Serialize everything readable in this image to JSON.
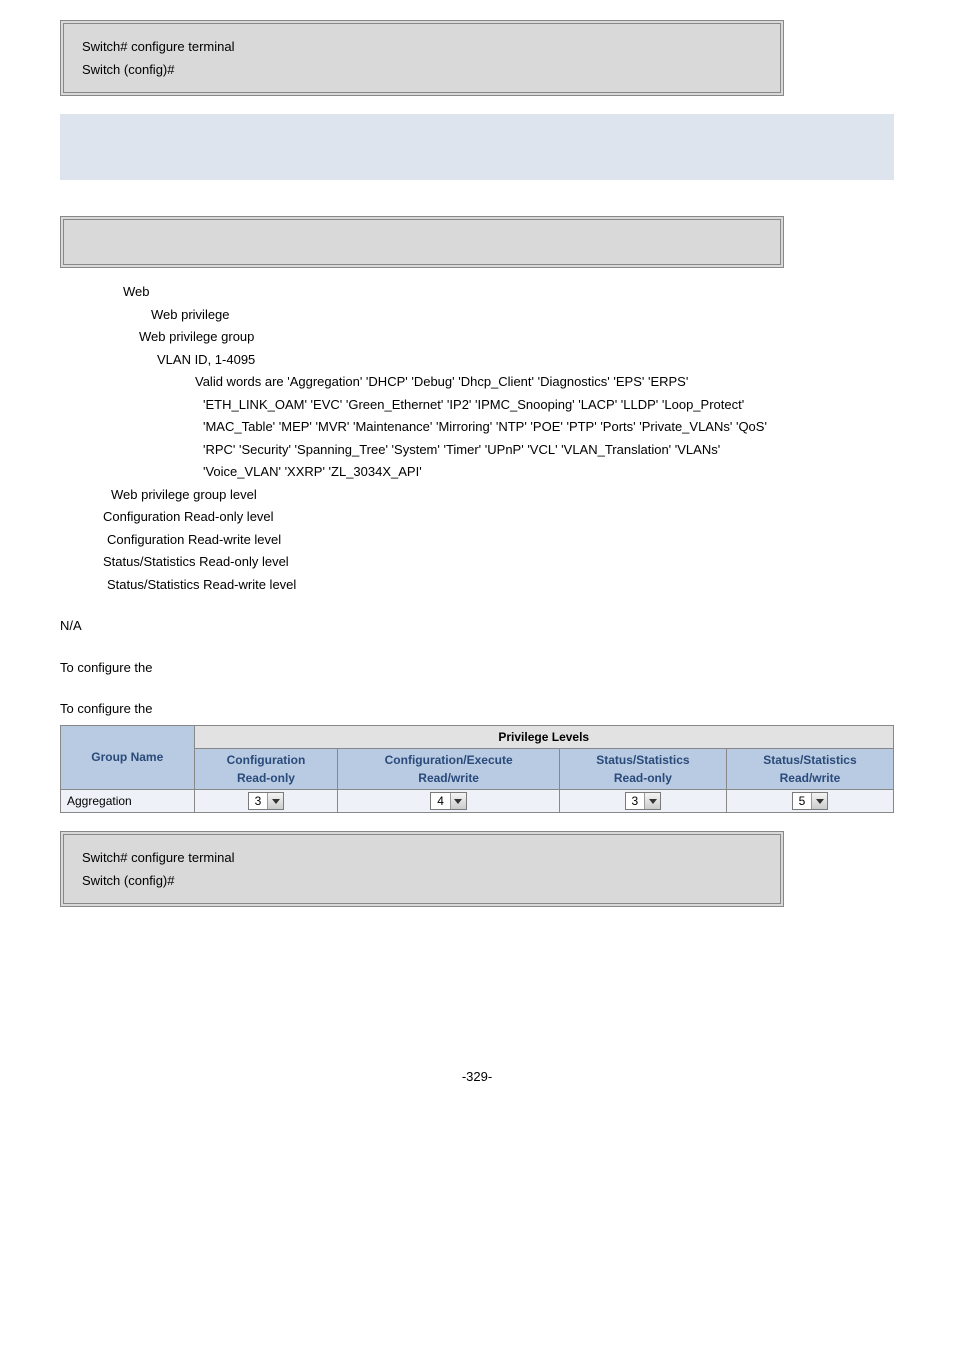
{
  "codebox1": {
    "line1": "Switch# configure terminal",
    "line2": "Switch (config)#"
  },
  "params": {
    "web": "Web",
    "web_privilege": "Web privilege",
    "web_priv_group": "Web privilege group",
    "vlan": "VLAN ID, 1-4095",
    "valid1": "Valid words are 'Aggregation' 'DHCP' 'Debug' 'Dhcp_Client' 'Diagnostics' 'EPS' 'ERPS'",
    "valid2": "'ETH_LINK_OAM' 'EVC' 'Green_Ethernet' 'IP2' 'IPMC_Snooping' 'LACP' 'LLDP' 'Loop_Protect'",
    "valid3": "'MAC_Table' 'MEP' 'MVR' 'Maintenance' 'Mirroring' 'NTP' 'POE' 'PTP' 'Ports' 'Private_VLANs' 'QoS'",
    "valid4": "'RPC' 'Security' 'Spanning_Tree' 'System' 'Timer' 'UPnP' 'VCL' 'VLAN_Translation' 'VLANs'",
    "valid5": "'Voice_VLAN' 'XXRP' 'ZL_3034X_API'",
    "grp_level": "Web privilege group level",
    "cfg_ro": "Configuration Read-only level",
    "cfg_rw": "Configuration Read-write level",
    "stat_ro": "Status/Statistics Read-only level",
    "stat_rw": "Status/Statistics Read-write level"
  },
  "na": "N/A",
  "configure1": "To configure the",
  "configure2": "To configure the",
  "table": {
    "title": "Privilege Levels",
    "col_gname": "Group Name",
    "col1a": "Configuration",
    "col1b": "Read-only",
    "col2a": "Configuration/Execute",
    "col2b": "Read/write",
    "col3a": "Status/Statistics",
    "col3b": "Read-only",
    "col4a": "Status/Statistics",
    "col4b": "Read/write",
    "row_name": "Aggregation",
    "v1": "3",
    "v2": "4",
    "v3": "3",
    "v4": "5"
  },
  "codebox2": {
    "line1": "Switch# configure terminal",
    "line2": "Switch (config)#"
  },
  "page": "-329-"
}
